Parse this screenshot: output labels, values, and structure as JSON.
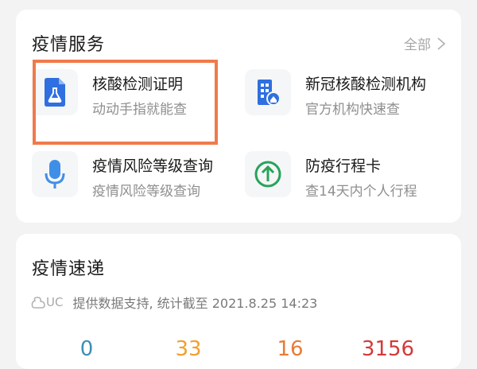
{
  "services": {
    "title": "疫情服务",
    "more_label": "全部",
    "items": [
      {
        "title": "核酸检测证明",
        "subtitle": "动动手指就能查",
        "icon": "lab-flask-document-icon"
      },
      {
        "title": "新冠核酸检测机构",
        "subtitle": "官方机构快速查",
        "icon": "hospital-building-icon"
      },
      {
        "title": "疫情风险等级查询",
        "subtitle": "疫情风险等级查询",
        "icon": "microphone-icon"
      },
      {
        "title": "防疫行程卡",
        "subtitle": "查14天内个人行程",
        "icon": "upload-circle-icon"
      }
    ]
  },
  "express": {
    "title": "疫情速递",
    "source_brand": "UC",
    "source_text": "提供数据支持, 统计截至 2021.8.25 14:23",
    "stats": [
      {
        "value": "0",
        "color": "#3a8fb7"
      },
      {
        "value": "33",
        "color": "#f0a030"
      },
      {
        "value": "16",
        "color": "#ea7a35"
      },
      {
        "value": "3156",
        "color": "#d23a3a"
      }
    ]
  },
  "colors": {
    "highlight_border": "#ef7a4a",
    "icon_blue": "#2f6fe0",
    "icon_green": "#27a35a",
    "icon_lightblue": "#3f8fe8"
  }
}
